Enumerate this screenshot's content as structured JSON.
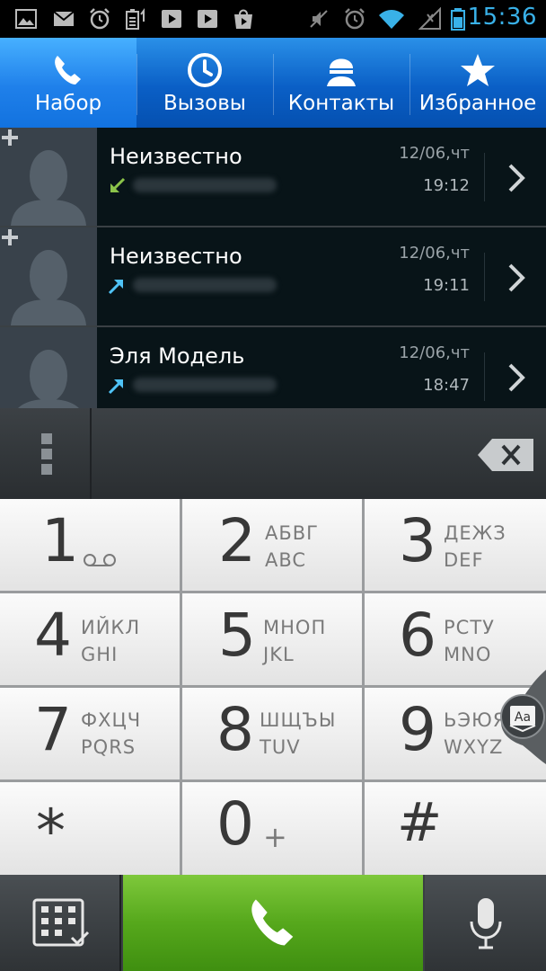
{
  "status_bar": {
    "time": "15:36",
    "icons": [
      "image-icon",
      "mail-icon",
      "alarm-icon",
      "battery-notify-icon",
      "video-icon",
      "play-icon",
      "store-icon",
      "mute-icon",
      "alarm-icon",
      "wifi-icon",
      "no-signal-icon",
      "battery-icon"
    ]
  },
  "tabs": [
    {
      "label": "Набор",
      "icon": "phone-icon",
      "active": true
    },
    {
      "label": "Вызовы",
      "icon": "clock-icon",
      "active": false
    },
    {
      "label": "Контакты",
      "icon": "contact-icon",
      "active": false
    },
    {
      "label": "Избранное",
      "icon": "star-icon",
      "active": false
    }
  ],
  "call_log": [
    {
      "name": "Неизвестно",
      "direction": "incoming",
      "date": "12/06,чт",
      "time": "19:12",
      "add_contact": true
    },
    {
      "name": "Неизвестно",
      "direction": "outgoing",
      "date": "12/06,чт",
      "time": "19:11",
      "add_contact": true
    },
    {
      "name": "Эля Модель",
      "direction": "outgoing",
      "date": "12/06,чт",
      "time": "18:47",
      "add_contact": false
    }
  ],
  "dialer": {
    "number": "",
    "keys": [
      {
        "digit": "1",
        "cyr": "",
        "lat": ""
      },
      {
        "digit": "2",
        "cyr": "АБВГ",
        "lat": "ABC"
      },
      {
        "digit": "3",
        "cyr": "ДЕЖЗ",
        "lat": "DEF"
      },
      {
        "digit": "4",
        "cyr": "ИЙКЛ",
        "lat": "GHI"
      },
      {
        "digit": "5",
        "cyr": "МНОП",
        "lat": "JKL"
      },
      {
        "digit": "6",
        "cyr": "РСТУ",
        "lat": "MNO"
      },
      {
        "digit": "7",
        "cyr": "ФХЦЧ",
        "lat": "PQRS"
      },
      {
        "digit": "8",
        "cyr": "ШЩЪЫ",
        "lat": "TUV"
      },
      {
        "digit": "9",
        "cyr": "ЬЭЮЯ",
        "lat": "WXYZ"
      },
      {
        "digit": "*",
        "cyr": "",
        "lat": ""
      },
      {
        "digit": "0",
        "cyr": "+",
        "lat": ""
      },
      {
        "digit": "#",
        "cyr": "",
        "lat": ""
      }
    ]
  },
  "colors": {
    "accent": "#39b1e8",
    "tab_bar": "#0a5fc6",
    "call_button": "#56a81c",
    "incoming_arrow": "#8bc34a",
    "outgoing_arrow": "#4fc3f7"
  }
}
